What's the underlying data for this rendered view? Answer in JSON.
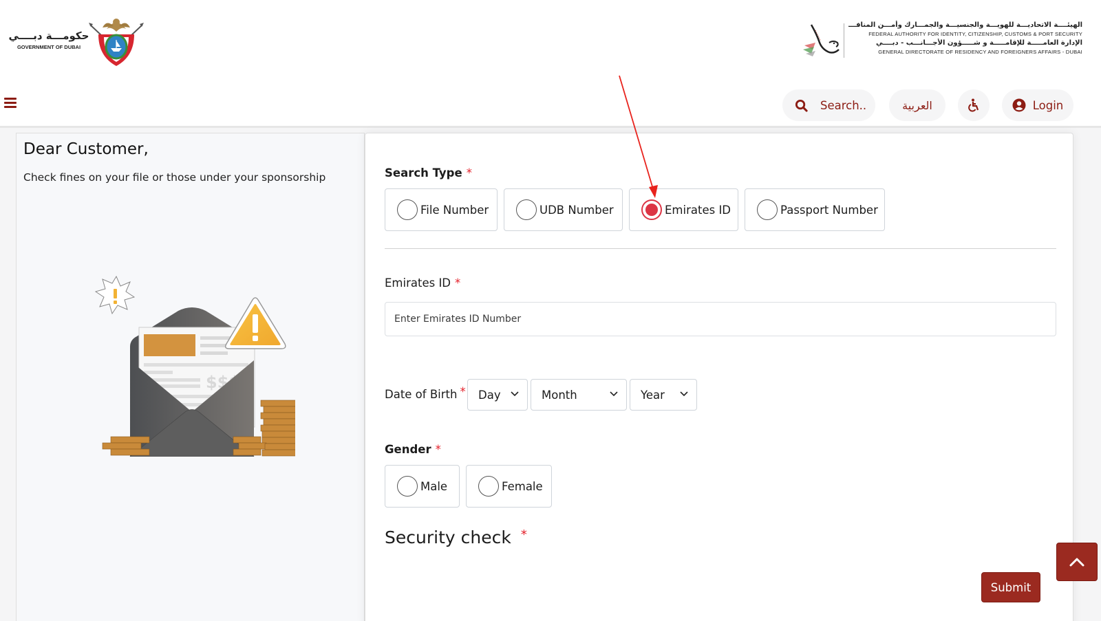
{
  "header": {
    "gov_logo": {
      "arabic": "حكومـــة دبــــي",
      "english": "GOVERNMENT OF DUBAI",
      "icon": "dubai-emblem-icon"
    },
    "ica_logo": {
      "line1_ar": "الهيئــــة الاتحاديـــة للهويـــة والجنسيـــة والجمـــارك وأمـــن المنافـــذ",
      "line1_en": "FEDERAL AUTHORITY FOR IDENTITY, CITIZENSHIP, CUSTOMS & PORT SECURITY",
      "line2_ar": "الإدارة العامـــــة للإقامـــــة و شـــــؤون الأجـــانـــب - دبــــي",
      "line2_en": "GENERAL DIRECTORATE OF RESIDENCY AND FOREIGNERS AFFAIRS - DUBAI",
      "icon": "falcon-logo-icon"
    },
    "menu_icon": "hamburger-menu-icon",
    "search_label": "Search..",
    "language_label": "العربية",
    "accessibility_icon": "wheelchair-icon",
    "login_label": "Login"
  },
  "left_panel": {
    "greeting": "Dear Customer,",
    "subtext": "Check fines on your file or those under your sponsorship",
    "illustration": {
      "icon": "fines-envelope-illustration",
      "money_text": "$$$"
    }
  },
  "form": {
    "search_type": {
      "label": "Search Type",
      "required_mark": "*",
      "options": [
        {
          "label": "File Number",
          "checked": false
        },
        {
          "label": "UDB Number",
          "checked": false
        },
        {
          "label": "Emirates ID",
          "checked": true
        },
        {
          "label": "Passport Number",
          "checked": false
        }
      ]
    },
    "emirates_id": {
      "label": "Emirates ID",
      "required_mark": "*",
      "value": "",
      "placeholder": "Enter Emirates ID Number"
    },
    "date_of_birth": {
      "label": "Date of Birth",
      "required_mark": "*",
      "day": "Day",
      "month": "Month",
      "year": "Year"
    },
    "gender": {
      "label": "Gender",
      "required_mark": "*",
      "options": [
        {
          "label": "Male",
          "checked": false
        },
        {
          "label": "Female",
          "checked": false
        }
      ]
    },
    "security_check": {
      "label": "Security check",
      "required_mark": "*"
    },
    "submit_label": "Submit"
  },
  "scroll_top_icon": "chevron-up-icon",
  "colors": {
    "brand": "#9b2a20",
    "brand_text": "#8c1c13",
    "radio_selected": "#dc3545",
    "required": "#e4202a",
    "annotation_arrow": "#e8231d"
  }
}
